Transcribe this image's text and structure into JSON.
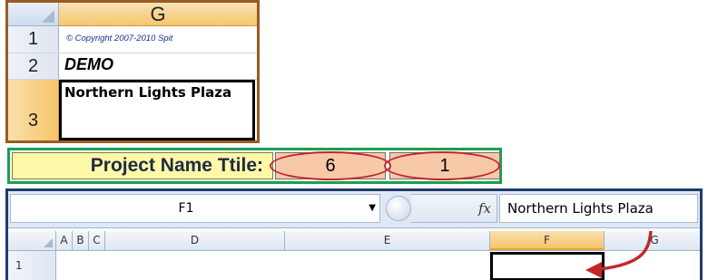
{
  "snippet": {
    "column_header": "G",
    "rows": [
      {
        "num": "1",
        "text": "© Copyright 2007-2010 Spit"
      },
      {
        "num": "2",
        "text": "DEMO"
      },
      {
        "num": "3",
        "text": "Northern Lights Plaza"
      }
    ]
  },
  "title_strip": {
    "label": "Project Name Ttile:",
    "values": [
      "6",
      "1"
    ]
  },
  "excel": {
    "name_box": "F1",
    "fx_label": "fx",
    "formula_value": "Northern Lights Plaza",
    "columns": [
      "A",
      "B",
      "C",
      "D",
      "E",
      "F",
      "G"
    ],
    "selected_column": "F",
    "row_number": "1"
  },
  "colors": {
    "snippet_border": "#9a5a24",
    "title_border": "#1aa04f",
    "title_label_bg": "#fff8a8",
    "title_cell_bg": "#f7c9a9",
    "oval_and_arrow": "#c3262a",
    "excel_border": "#1f3d6b",
    "selected_header": "#f5c46b"
  }
}
